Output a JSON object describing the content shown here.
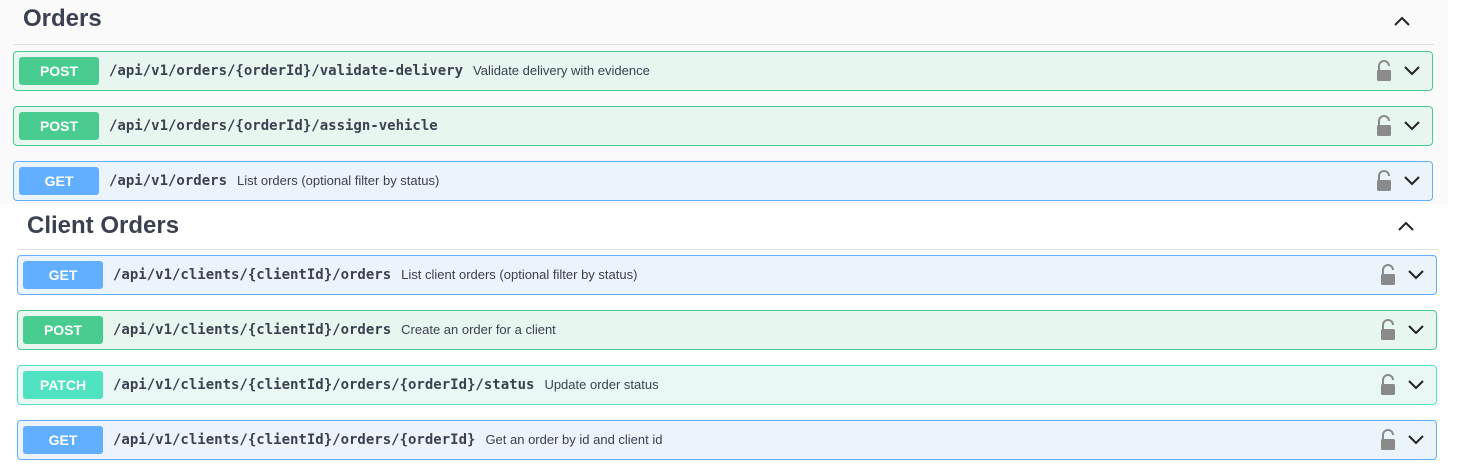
{
  "sections": [
    {
      "title": "Orders",
      "operations": [
        {
          "method": "POST",
          "path": "/api/v1/orders/{orderId}/validate-delivery",
          "summary": "Validate delivery with evidence"
        },
        {
          "method": "POST",
          "path": "/api/v1/orders/{orderId}/assign-vehicle",
          "summary": ""
        },
        {
          "method": "GET",
          "path": "/api/v1/orders",
          "summary": "List orders (optional filter by status)"
        }
      ]
    },
    {
      "title": "Client Orders",
      "operations": [
        {
          "method": "GET",
          "path": "/api/v1/clients/{clientId}/orders",
          "summary": "List client orders (optional filter by status)"
        },
        {
          "method": "POST",
          "path": "/api/v1/clients/{clientId}/orders",
          "summary": "Create an order for a client"
        },
        {
          "method": "PATCH",
          "path": "/api/v1/clients/{clientId}/orders/{orderId}/status",
          "summary": "Update order status"
        },
        {
          "method": "GET",
          "path": "/api/v1/clients/{clientId}/orders/{orderId}",
          "summary": "Get an order by id and client id"
        }
      ]
    }
  ],
  "icons": {
    "lock": "lock-icon",
    "expand": "chevron-down-icon",
    "collapse": "chevron-up-icon"
  },
  "colors": {
    "post": "#49cc90",
    "get": "#61affe",
    "patch": "#50e3c2"
  }
}
